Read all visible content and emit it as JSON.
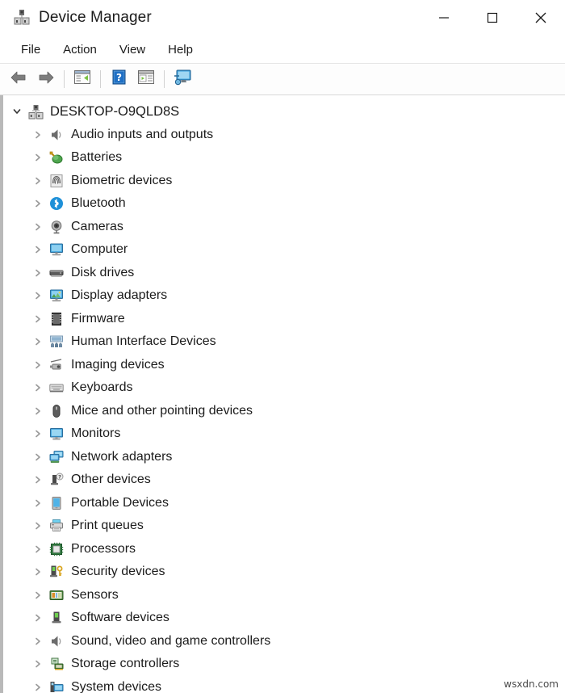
{
  "window": {
    "title": "Device Manager",
    "title_icon": "device-manager-icon",
    "minimize_label": "Minimize",
    "maximize_label": "Maximize",
    "close_label": "Close"
  },
  "menubar": {
    "items": [
      {
        "label": "File"
      },
      {
        "label": "Action"
      },
      {
        "label": "View"
      },
      {
        "label": "Help"
      }
    ]
  },
  "toolbar": {
    "buttons": [
      {
        "name": "back-button",
        "icon": "back-arrow-icon",
        "label": "Back"
      },
      {
        "name": "forward-button",
        "icon": "forward-arrow-icon",
        "label": "Forward"
      },
      {
        "name": "show-hide-console-tree-button",
        "icon": "console-tree-icon",
        "label": "Show/hide console tree"
      },
      {
        "name": "help-button",
        "icon": "help-question-icon",
        "label": "Help"
      },
      {
        "name": "properties-button",
        "icon": "properties-icon",
        "label": "Properties"
      },
      {
        "name": "scan-hardware-changes-button",
        "icon": "scan-monitor-icon",
        "label": "Scan for hardware changes"
      }
    ]
  },
  "tree": {
    "root": {
      "label": "DESKTOP-O9QLD8S",
      "icon": "computer-node-icon",
      "expanded": true,
      "chevron": "chevron-down-icon"
    },
    "items": [
      {
        "label": "Audio inputs and outputs",
        "icon": "speaker-icon",
        "chevron": "chevron-right-icon"
      },
      {
        "label": "Batteries",
        "icon": "battery-icon",
        "chevron": "chevron-right-icon"
      },
      {
        "label": "Biometric devices",
        "icon": "fingerprint-icon",
        "chevron": "chevron-right-icon"
      },
      {
        "label": "Bluetooth",
        "icon": "bluetooth-icon",
        "chevron": "chevron-right-icon"
      },
      {
        "label": "Cameras",
        "icon": "camera-icon",
        "chevron": "chevron-right-icon"
      },
      {
        "label": "Computer",
        "icon": "computer-icon",
        "chevron": "chevron-right-icon"
      },
      {
        "label": "Disk drives",
        "icon": "disk-drive-icon",
        "chevron": "chevron-right-icon"
      },
      {
        "label": "Display adapters",
        "icon": "display-adapter-icon",
        "chevron": "chevron-right-icon"
      },
      {
        "label": "Firmware",
        "icon": "firmware-chip-icon",
        "chevron": "chevron-right-icon"
      },
      {
        "label": "Human Interface Devices",
        "icon": "hid-icon",
        "chevron": "chevron-right-icon"
      },
      {
        "label": "Imaging devices",
        "icon": "imaging-device-icon",
        "chevron": "chevron-right-icon"
      },
      {
        "label": "Keyboards",
        "icon": "keyboard-icon",
        "chevron": "chevron-right-icon"
      },
      {
        "label": "Mice and other pointing devices",
        "icon": "mouse-icon",
        "chevron": "chevron-right-icon"
      },
      {
        "label": "Monitors",
        "icon": "monitor-icon",
        "chevron": "chevron-right-icon"
      },
      {
        "label": "Network adapters",
        "icon": "network-adapter-icon",
        "chevron": "chevron-right-icon"
      },
      {
        "label": "Other devices",
        "icon": "other-device-icon",
        "chevron": "chevron-right-icon"
      },
      {
        "label": "Portable Devices",
        "icon": "portable-device-icon",
        "chevron": "chevron-right-icon"
      },
      {
        "label": "Print queues",
        "icon": "printer-icon",
        "chevron": "chevron-right-icon"
      },
      {
        "label": "Processors",
        "icon": "processor-icon",
        "chevron": "chevron-right-icon"
      },
      {
        "label": "Security devices",
        "icon": "security-key-icon",
        "chevron": "chevron-right-icon"
      },
      {
        "label": "Sensors",
        "icon": "sensor-icon",
        "chevron": "chevron-right-icon"
      },
      {
        "label": "Software devices",
        "icon": "software-device-icon",
        "chevron": "chevron-right-icon"
      },
      {
        "label": "Sound, video and game controllers",
        "icon": "sound-controller-icon",
        "chevron": "chevron-right-icon"
      },
      {
        "label": "Storage controllers",
        "icon": "storage-controller-icon",
        "chevron": "chevron-right-icon"
      },
      {
        "label": "System devices",
        "icon": "system-device-icon",
        "chevron": "chevron-right-icon"
      }
    ]
  },
  "watermark": {
    "text": "wsxdn.com"
  },
  "colors": {
    "window_bg": "#ffffff",
    "text": "#1b1b1b",
    "chevron": "#9a9a9a",
    "accent_blue": "#1e90d8",
    "panel_border": "#b9b9b9"
  }
}
